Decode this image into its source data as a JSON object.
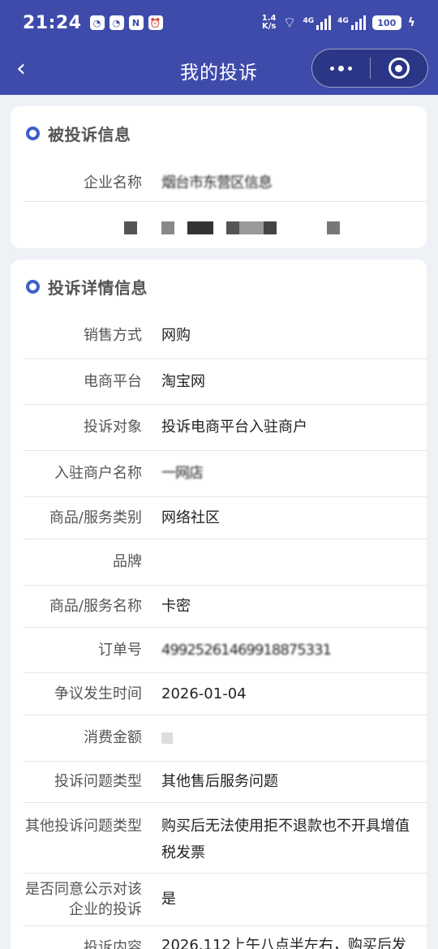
{
  "status_bar": {
    "time": "21:24",
    "net_speed_value": "1.4",
    "net_speed_unit": "K/s",
    "signal1_label": "4G",
    "signal2_label": "4G",
    "battery": "100"
  },
  "nav": {
    "title": "我的投诉"
  },
  "complainee_section": {
    "title": "被投诉信息",
    "company_label": "企业名称",
    "company_value": "烟台市东营区信息"
  },
  "detail_section": {
    "title": "投诉详情信息",
    "rows": [
      {
        "label": "销售方式",
        "value": "网购"
      },
      {
        "label": "电商平台",
        "value": "淘宝网"
      },
      {
        "label": "投诉对象",
        "value": "投诉电商平台入驻商户"
      },
      {
        "label": "入驻商户名称",
        "value": "一网店"
      },
      {
        "label": "商品/服务类别",
        "value": "网络社区"
      },
      {
        "label": "品牌",
        "value": ""
      },
      {
        "label": "商品/服务名称",
        "value": "卡密"
      },
      {
        "label": "订单号",
        "value": "49925261469918875331"
      },
      {
        "label": "争议发生时间",
        "value": "2026-01-04"
      },
      {
        "label": "消费金额",
        "value": ""
      },
      {
        "label": "投诉问题类型",
        "value": "其他售后服务问题"
      },
      {
        "label": "其他投诉问题类型",
        "value": "购买后无法使用拒不退款也不开具增值税发票"
      },
      {
        "label": "是否同意公示对该企业的投诉",
        "value": "是"
      },
      {
        "label": "投诉内容",
        "value": "2026.112上午八点半左右，购买后发"
      }
    ]
  },
  "colors": {
    "header_bg": "#3f4bab",
    "page_bg": "#eef1f6",
    "section_dot": "#3f60c9"
  }
}
